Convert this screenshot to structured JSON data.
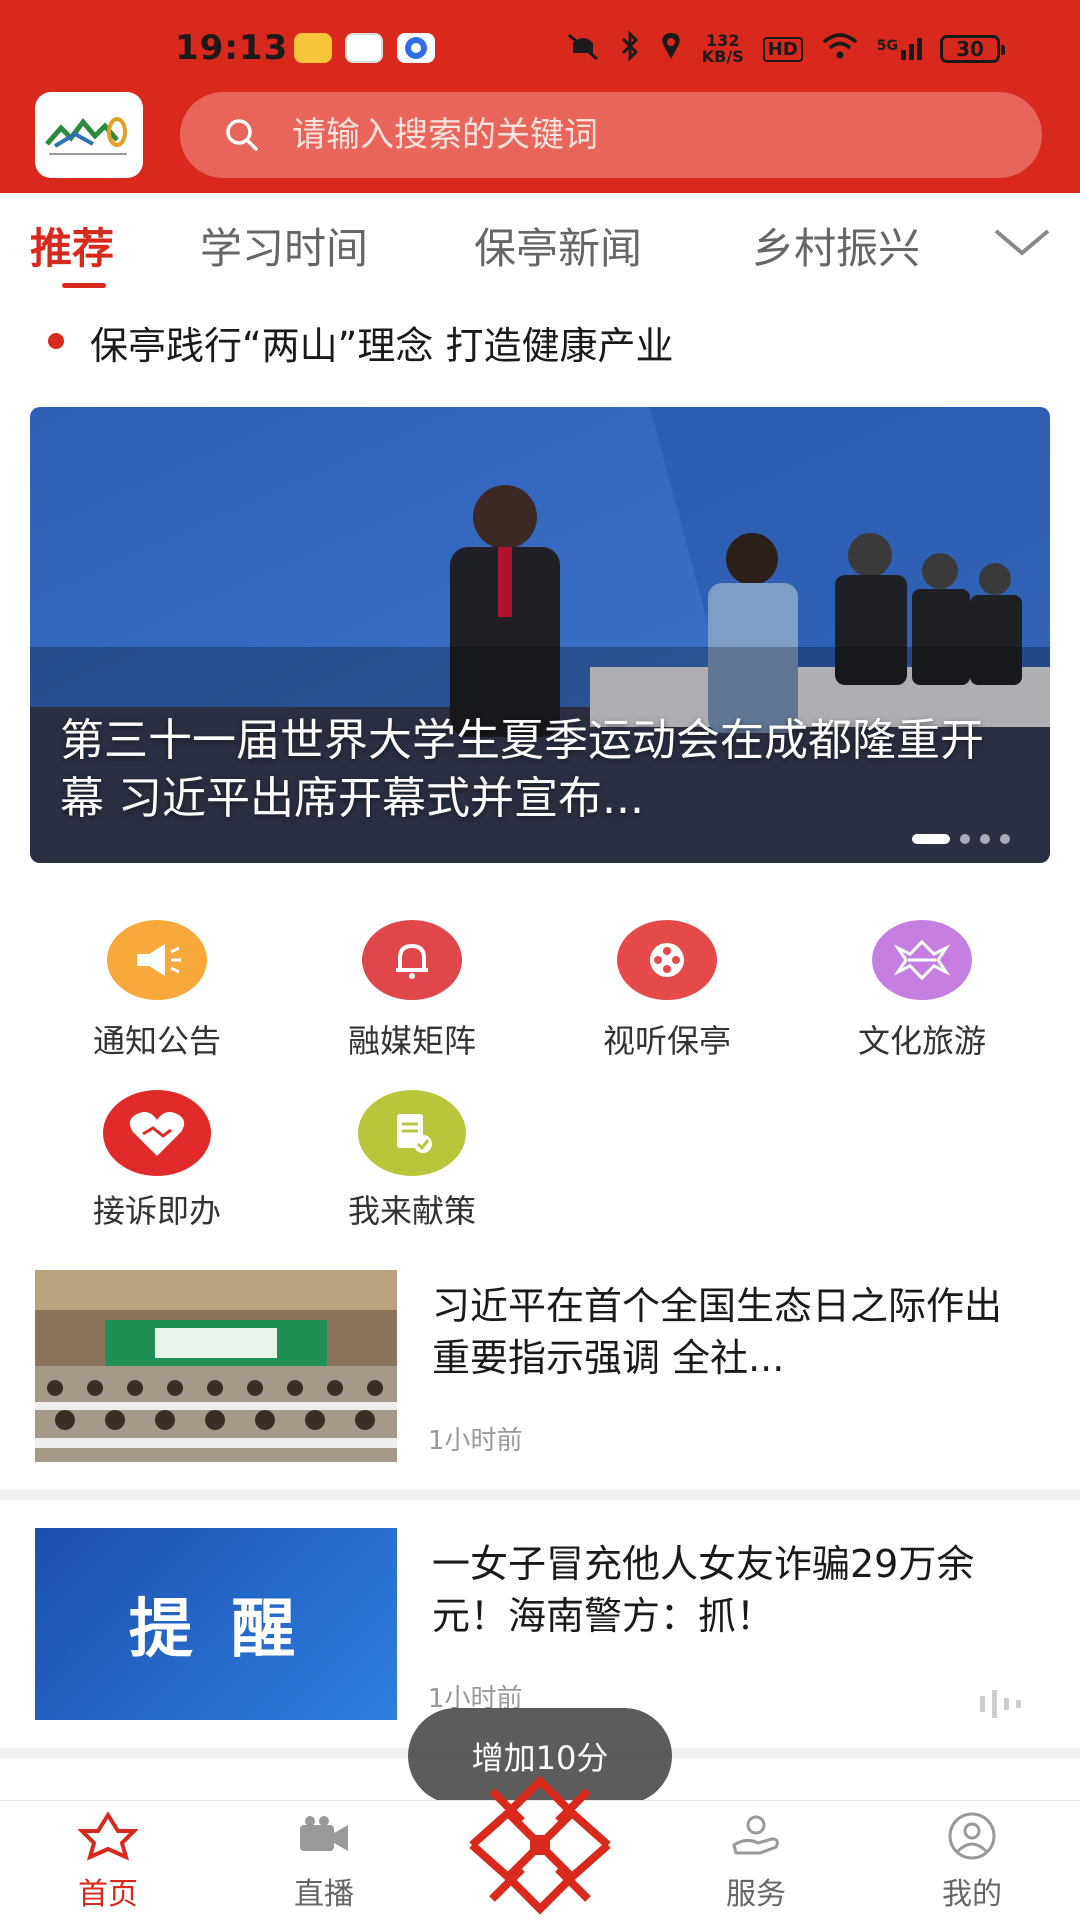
{
  "status_bar": {
    "time": "19:13",
    "net_speed": "132 KB/S",
    "hd": "HD",
    "network": "5G",
    "battery": "30"
  },
  "search": {
    "placeholder": "请输入搜索的关键词"
  },
  "tabs": [
    {
      "label": "推荐",
      "active": true
    },
    {
      "label": "学习时间"
    },
    {
      "label": "保亭新闻"
    },
    {
      "label": "乡村振兴"
    }
  ],
  "ticker": {
    "text": "保亭践行“两山”理念  打造健康产业"
  },
  "banner": {
    "title": "第三十一届世界大学生夏季运动会在成都隆重开幕  习近平出席开幕式并宣布..."
  },
  "services": [
    {
      "label": "通知公告",
      "icon": "megaphone-icon",
      "color": "#f6a83b"
    },
    {
      "label": "融媒矩阵",
      "icon": "bell-icon",
      "color": "#e0474a"
    },
    {
      "label": "视听保亭",
      "icon": "film-reel-icon",
      "color": "#e54a4a"
    },
    {
      "label": "文化旅游",
      "icon": "culture-pattern-icon",
      "color": "#c57fe0"
    },
    {
      "label": "接诉即办",
      "icon": "handshake-heart-icon",
      "color": "#e02a2a"
    },
    {
      "label": "我来献策",
      "icon": "document-check-icon",
      "color": "#b9c63c"
    }
  ],
  "news": [
    {
      "title": "习近平在首个全国生态日之际作出重要指示强调  全社...",
      "time": "1小时前",
      "thumb_text": ""
    },
    {
      "title": "一女子冒充他人女友诈骗29万余元！海南警方：抓！",
      "time": "1小时前",
      "thumb_text": "提 醒"
    }
  ],
  "toast": {
    "text": "增加10分"
  },
  "bottom_nav": [
    {
      "label": "首页",
      "active": true
    },
    {
      "label": "直播"
    },
    {
      "label": "服务"
    },
    {
      "label": "我的"
    }
  ],
  "colors": {
    "brand_red": "#d9291c",
    "search_bg": "#e8655b"
  }
}
